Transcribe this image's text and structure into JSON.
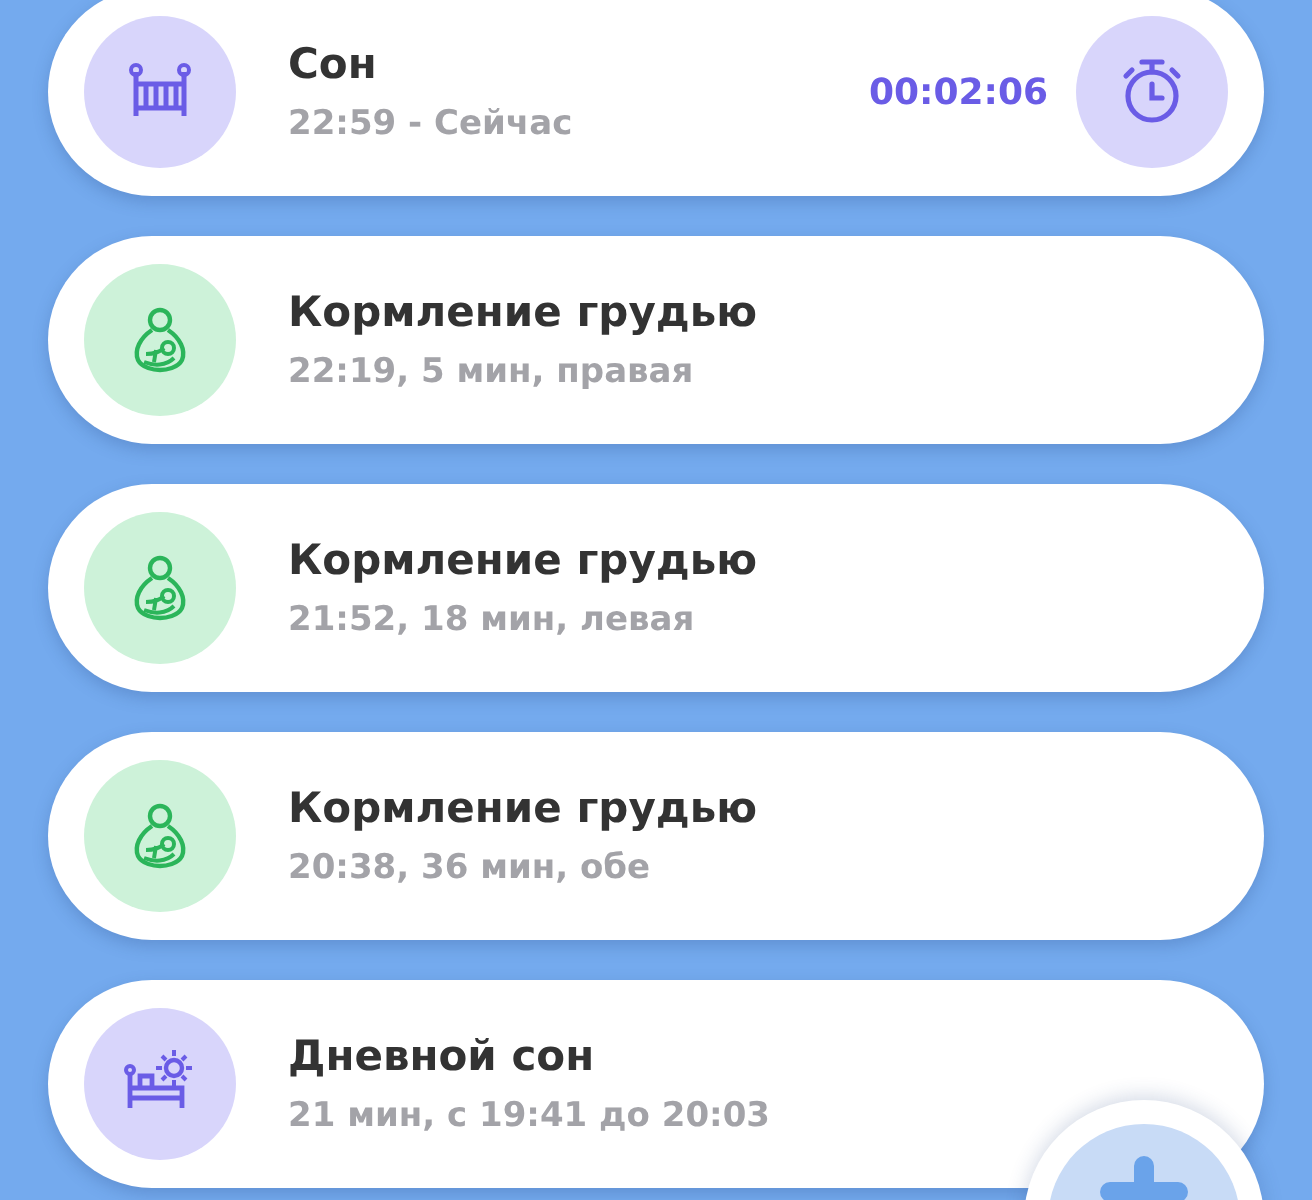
{
  "entries": [
    {
      "kind": "sleep",
      "title": "Сон",
      "subtitle": "22:59 - Сейчас",
      "timer": "00:02:06"
    },
    {
      "kind": "breastfeeding",
      "title": "Кормление грудью",
      "subtitle": "22:19, 5 мин, правая"
    },
    {
      "kind": "breastfeeding",
      "title": "Кормление грудью",
      "subtitle": "21:52, 18 мин, левая"
    },
    {
      "kind": "breastfeeding",
      "title": "Кормление грудью",
      "subtitle": "20:38, 36 мин, обе"
    },
    {
      "kind": "nap",
      "title": "Дневной сон",
      "subtitle": "21 мин, с 19:41 до 20:03"
    }
  ]
}
